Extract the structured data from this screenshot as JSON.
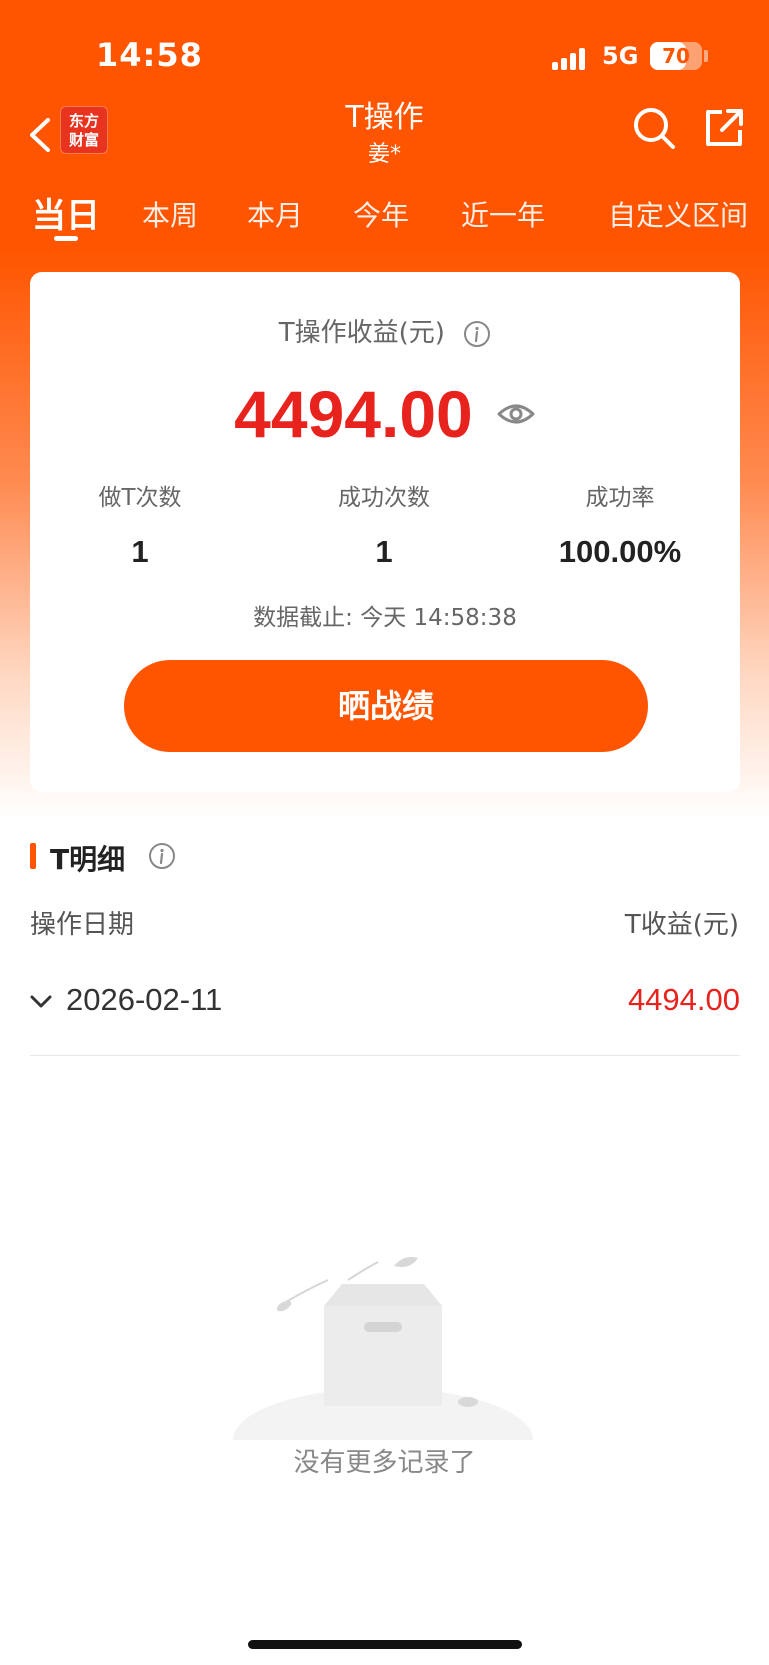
{
  "status_bar": {
    "time": "14:58",
    "network": "5G",
    "battery": "70",
    "battery_level": 0.7
  },
  "header": {
    "logo_line1": "东方",
    "logo_line2": "财富",
    "title": "T操作",
    "subtitle": "姜*",
    "icons": [
      "back-icon",
      "search-icon",
      "share-icon"
    ]
  },
  "tabs": [
    {
      "label": "当日",
      "active": true
    },
    {
      "label": "本周",
      "active": false
    },
    {
      "label": "本月",
      "active": false
    },
    {
      "label": "今年",
      "active": false
    },
    {
      "label": "近一年",
      "active": false
    },
    {
      "label": "自定义区间",
      "active": false
    }
  ],
  "summary": {
    "title": "T操作收益(元)",
    "profit": "4494.00",
    "stats": [
      {
        "label": "做T次数",
        "value": "1"
      },
      {
        "label": "成功次数",
        "value": "1"
      },
      {
        "label": "成功率",
        "value": "100.00%"
      }
    ],
    "as_of": "数据截止: 今天 14:58:38",
    "share_button": "晒战绩"
  },
  "details": {
    "title": "T明细",
    "col_date": "操作日期",
    "col_profit": "T收益(元)",
    "rows": [
      {
        "date": "2026-02-11",
        "profit": "4494.00"
      }
    ]
  },
  "empty": {
    "text": "没有更多记录了"
  },
  "colors": {
    "brand": "#ff5500",
    "profit_red": "#e8231e"
  }
}
